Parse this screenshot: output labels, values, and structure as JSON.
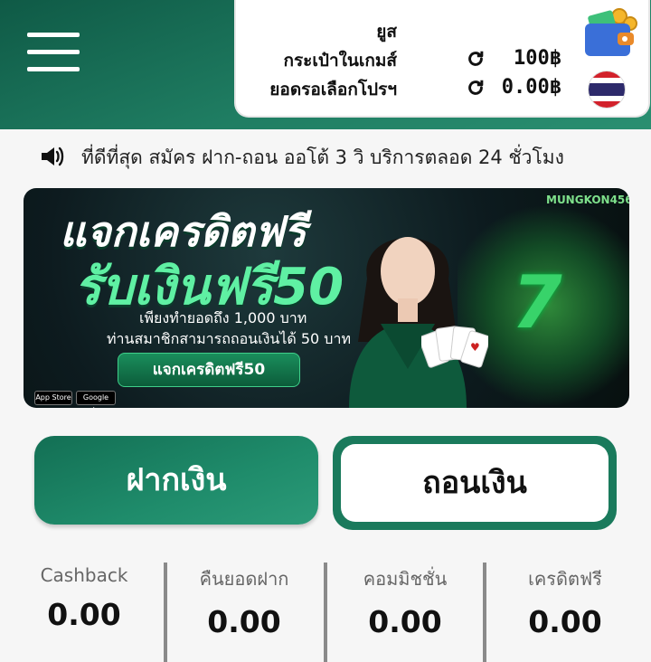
{
  "header": {
    "menu_icon": "hamburger-menu-icon",
    "wallet": {
      "username_label": "ยูส",
      "ingame_wallet_label": "กระเป๋าในเกมส์",
      "pending_promo_label": "ยอดรอเลือกโปรฯ",
      "ingame_balance": "100฿",
      "pending_balance": "0.00฿",
      "refresh_icon": "refresh-icon",
      "wallet_icon": "wallet-coins-icon",
      "language_flag": "thailand-flag-icon"
    }
  },
  "marquee": {
    "icon": "speaker-icon",
    "text": "ที่ดีที่สุด สมัคร ฝาก-ถอน ออโต้ 3 วิ บริการตลอด 24 ชั่วโมง"
  },
  "banner": {
    "title_line1": "แจกเครดิตฟรี",
    "title_line2": "รับเงินฟรี50",
    "subtitle_line1": "เพียงทำยอดถึง 1,000 บาท",
    "subtitle_line2": "ท่านสมาชิกสามารถถอนเงินได้ 50 บาท",
    "cta_label": "แจกเครดิตฟรี50",
    "brand_logo": "MUNGKON456",
    "app_store_badge": "App Store",
    "google_play_badge": "Google play",
    "accent_color": "#5ff0a3"
  },
  "actions": {
    "deposit_label": "ฝากเงิน",
    "withdraw_label": "ถอนเงิน",
    "primary_color": "#1a7a5c"
  },
  "stats": [
    {
      "label": "Cashback",
      "value": "0.00"
    },
    {
      "label": "คืนยอดฝาก",
      "value": "0.00"
    },
    {
      "label": "คอมมิชชั่น",
      "value": "0.00"
    },
    {
      "label": "เครดิตฟรี",
      "value": "0.00"
    }
  ]
}
